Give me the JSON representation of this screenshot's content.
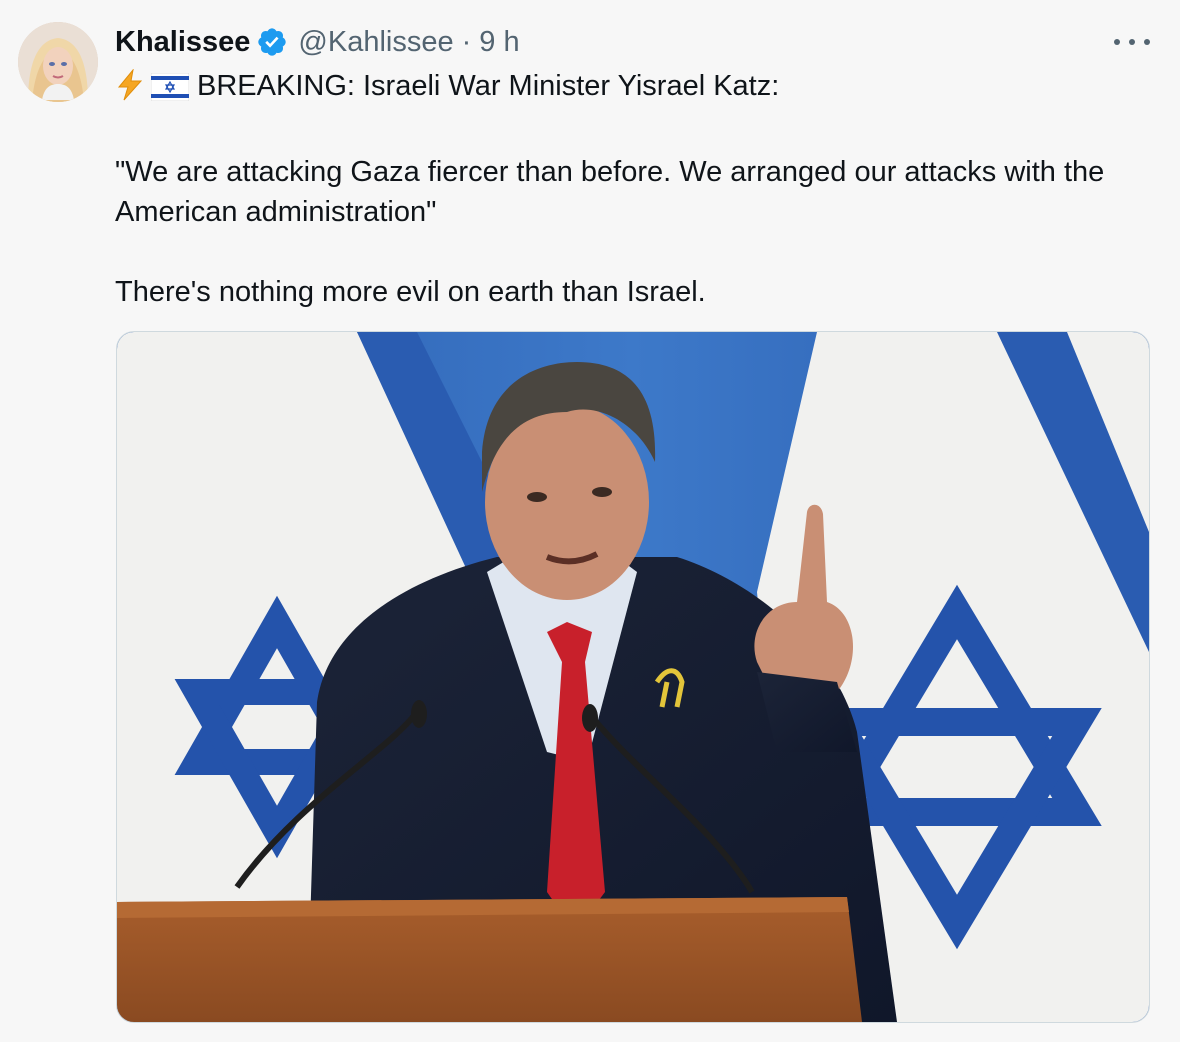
{
  "tweet": {
    "author": {
      "display_name": "Khalissee",
      "handle": "@Kahlissee",
      "verified": true
    },
    "time": "9 h",
    "separator": "·",
    "text": {
      "line1_emoji": [
        "lightning-emoji",
        "israel-flag-emoji"
      ],
      "line1": "BREAKING: Israeli War Minister Yisrael Katz:",
      "quote": "\"We are attacking Gaza fiercer than before. We arranged our attacks with the American administration\"",
      "comment": "There's nothing more evil on earth than Israel."
    },
    "media": {
      "type": "photo",
      "subject": "speaker at podium in front of Israeli flags"
    }
  },
  "colors": {
    "background": "#f7f7f7",
    "text": "#0f1419",
    "secondary": "#536471",
    "verified_badge": "#1d9bf0",
    "flag_blue": "#1f4fb4"
  },
  "icons": {
    "verified": "verified-badge-icon",
    "more": "more-options-icon"
  }
}
